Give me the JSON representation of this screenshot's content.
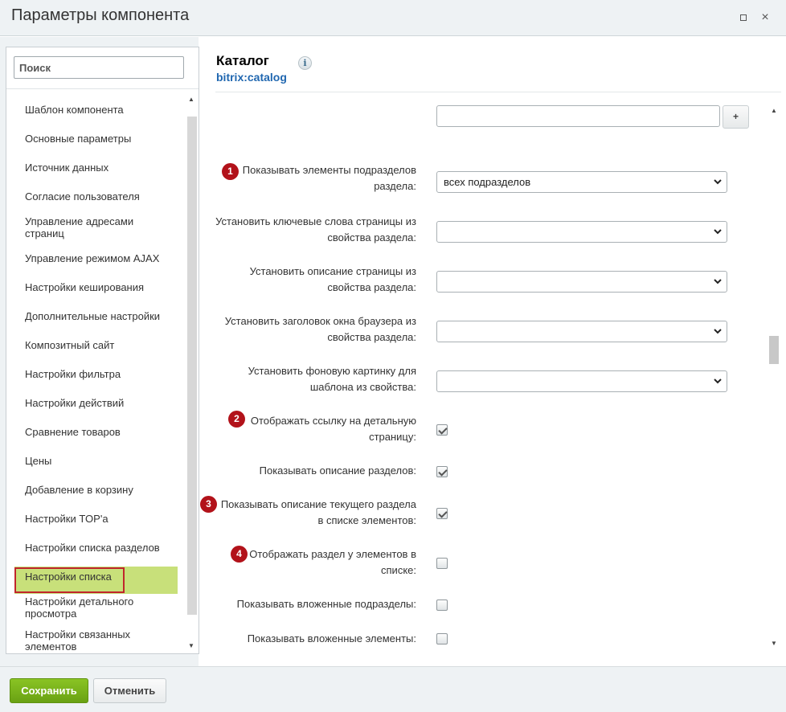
{
  "window": {
    "title": "Параметры компонента",
    "maximize_icon": "maximize-icon",
    "close_icon": "close-icon",
    "close_glyph": "×"
  },
  "sidebar": {
    "search_placeholder": "Поиск",
    "items": [
      "Шаблон компонента",
      "Основные параметры",
      "Источник данных",
      "Согласие пользователя",
      "Управление адресами страниц",
      "Управление режимом AJAX",
      "Настройки кеширования",
      "Дополнительные настройки",
      "Композитный сайт",
      "Настройки фильтра",
      "Настройки действий",
      "Сравнение товаров",
      "Цены",
      "Добавление в корзину",
      "Настройки TOP'а",
      "Настройки списка разделов",
      "Настройки списка",
      "Настройки детального просмотра",
      "Настройки связанных элементов"
    ],
    "active_item": "Настройки списка",
    "highlight_color": "#c8e07a",
    "frame_color": "#c0262c"
  },
  "component": {
    "title": "Каталог",
    "code": "bitrix:catalog",
    "info_glyph": "i"
  },
  "form": {
    "plus_label": "+",
    "rows": [
      {
        "label": "Показывать элементы подразделов раздела:",
        "type": "select",
        "value": "всех подразделов",
        "badge": "1"
      },
      {
        "label": "Установить ключевые слова страницы из свойства раздела:",
        "type": "select",
        "value": ""
      },
      {
        "label": "Установить описание страницы из свойства раздела:",
        "type": "select",
        "value": ""
      },
      {
        "label": "Установить заголовок окна браузера из свойства раздела:",
        "type": "select",
        "value": ""
      },
      {
        "label": "Установить фоновую картинку для шаблона из свойства:",
        "type": "select",
        "value": ""
      },
      {
        "label": "Отображать ссылку на детальную страницу:",
        "type": "checkbox",
        "checked": true,
        "badge": "2"
      },
      {
        "label": "Показывать описание разделов:",
        "type": "checkbox",
        "checked": true
      },
      {
        "label": "Показывать описание текущего раздела в списке элементов:",
        "type": "checkbox",
        "checked": true,
        "badge": "3"
      },
      {
        "label": "Отображать раздел у элементов в списке:",
        "type": "checkbox",
        "checked": false,
        "badge": "4"
      },
      {
        "label": "Показывать вложенные подразделы:",
        "type": "checkbox",
        "checked": false
      },
      {
        "label": "Показывать вложенные элементы:",
        "type": "checkbox",
        "checked": false
      }
    ]
  },
  "footer": {
    "save_label": "Сохранить",
    "cancel_label": "Отменить",
    "save_color": "#7cb61d"
  }
}
